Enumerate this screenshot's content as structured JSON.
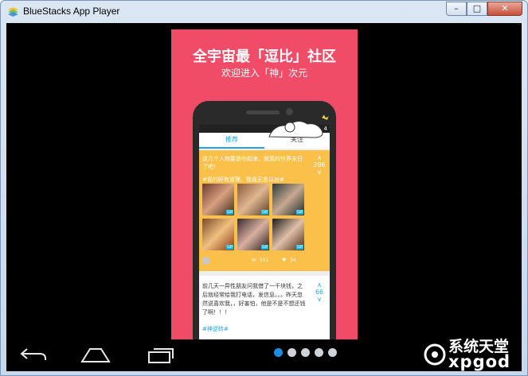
{
  "window": {
    "title": "BlueStacks App Player",
    "minimize_icon": "minimize-icon",
    "maximize_icon": "maximize-icon",
    "close_icon": "close-icon"
  },
  "slide": {
    "headline": "全宇宙最「逗比」社区",
    "subline": "欢迎进入「神」次元",
    "background_color": "#f04b67"
  },
  "app": {
    "tabs": [
      {
        "label": "推荐",
        "active": true
      },
      {
        "label": "关注",
        "active": false
      }
    ],
    "card1": {
      "text": "这几个人物要是吵起来，就真的世界末日了吧！",
      "tag": "#说的好有道理，我竟无言以对#",
      "vote_count": "286",
      "gif_label": "Gif",
      "stats_comments": "151",
      "stats_likes": "34"
    },
    "card2": {
      "text": "前几天一异性朋友问我借了一千块钱，之后就经常给我打电话，发信息。。。昨天忽然说喜欢我，，好害怕，他是不是不想还钱了啊！！！",
      "tag": "#神逆转#",
      "vote_count": "66"
    }
  },
  "navbar": {
    "back_icon": "back-icon",
    "home_icon": "home-icon",
    "recent_icon": "recent-apps-icon",
    "page_count": 5,
    "active_page": 1
  },
  "watermark": {
    "top": "系统天堂",
    "bottom": "xpgod"
  }
}
